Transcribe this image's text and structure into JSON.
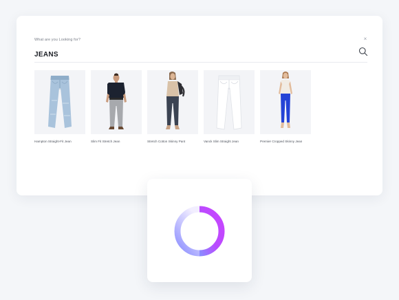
{
  "search": {
    "prompt": "What are you Looking for?",
    "query": "JEANS",
    "close_label": "×"
  },
  "products": [
    {
      "name": "Hampton Straight-Fit Jean"
    },
    {
      "name": "Slim Fit Stretch Jean"
    },
    {
      "name": "Stretch Cotton Skinny Pant"
    },
    {
      "name": "Vanck Slim Straight Jean"
    },
    {
      "name": "Premier Cropped Skinny Jean"
    }
  ],
  "loader": {
    "gradient_start": "#c945ff",
    "gradient_end": "#8a8cff"
  }
}
